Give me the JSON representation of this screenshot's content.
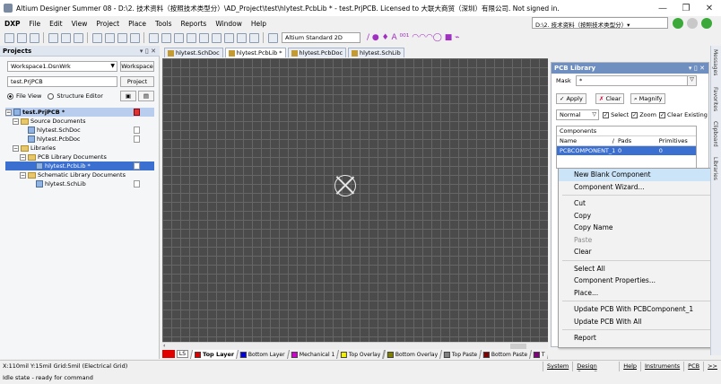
{
  "window": {
    "title": "Altium Designer Summer 08 - D:\\2. 技术资料（按照技术类型分）\\AD_Project\\test\\hlytest.PcbLib * - test.PrjPCB. Licensed to 大联大商贸（深圳）有限公司. Not signed in.",
    "minimize": "—",
    "restore": "❐",
    "close": "✕"
  },
  "menu": {
    "items": [
      "DXP",
      "File",
      "Edit",
      "View",
      "Project",
      "Place",
      "Tools",
      "Reports",
      "Window",
      "Help"
    ],
    "path": "D:\\2. 技术资料（按照技术类型分）▾"
  },
  "toolbar": {
    "view_select": "Altium Standard 2D",
    "glyphs": "/ ● ♦ A ⁰⁰¹ ◠◠◠◯ ■ ⌁"
  },
  "projects_panel": {
    "title": "Projects",
    "pin": "▾ ▯ ✕",
    "workspace": "Workspace1.DsnWrk",
    "workspace_btn": "Workspace",
    "project": "test.PrjPCB",
    "project_btn": "Project",
    "file_view": "File View",
    "structure_editor": "Structure Editor",
    "tree": [
      {
        "label": "test.PrjPCB *",
        "level": 0,
        "kind": "project"
      },
      {
        "label": "Source Documents",
        "level": 1,
        "kind": "folder"
      },
      {
        "label": "hlytest.SchDoc",
        "level": 2,
        "kind": "doc"
      },
      {
        "label": "hlytest.PcbDoc",
        "level": 2,
        "kind": "doc"
      },
      {
        "label": "Libraries",
        "level": 1,
        "kind": "folder"
      },
      {
        "label": "PCB Library Documents",
        "level": 2,
        "kind": "folder"
      },
      {
        "label": "hlytest.PcbLib *",
        "level": 3,
        "kind": "selected"
      },
      {
        "label": "Schematic Library Documents",
        "level": 2,
        "kind": "folder"
      },
      {
        "label": "hlytest.SchLib",
        "level": 3,
        "kind": "doc"
      }
    ]
  },
  "doc_tabs": [
    "hlytest.SchDoc",
    "hlytest.PcbLib *",
    "hlytest.PcbDoc",
    "hlytest.SchLib"
  ],
  "layers": {
    "ls": "LS",
    "items": [
      {
        "label": "Top Layer",
        "color": "#e00000",
        "active": true
      },
      {
        "label": "Bottom Layer",
        "color": "#0000e0"
      },
      {
        "label": "Mechanical 1",
        "color": "#d000d0"
      },
      {
        "label": "Top Overlay",
        "color": "#f0f000"
      },
      {
        "label": "Bottom Overlay",
        "color": "#808000"
      },
      {
        "label": "Top Paste",
        "color": "#808080"
      },
      {
        "label": "Bottom Paste",
        "color": "#800000"
      },
      {
        "label": "T",
        "color": "#800080"
      }
    ]
  },
  "pcb_library": {
    "title": "PCB Library",
    "pin": "▾ ▯ ✕",
    "mask_label": "Mask",
    "mask_value": "*",
    "apply": "Apply",
    "clear": "Clear",
    "magnify": "Magnify",
    "normal": "Normal",
    "select": "Select",
    "zoom": "Zoom",
    "clear_existing": "Clear Existing",
    "components_caption": "Components",
    "col_name": "Name",
    "col_sort": "/",
    "col_pads": "Pads",
    "col_primitives": "Primitives",
    "row": {
      "name": "PCBCOMPONENT_1",
      "pads": "0",
      "primitives": "0"
    }
  },
  "context_menu": {
    "groups": [
      [
        "New Blank Component",
        "Component Wizard..."
      ],
      [
        "Cut",
        "Copy",
        "Copy Name",
        "Paste",
        "Clear"
      ],
      [
        "Select All",
        "Component Properties...",
        "Place..."
      ],
      [
        "Update PCB With PCBComponent_1",
        "Update PCB With All"
      ],
      [
        "Report"
      ]
    ],
    "highlighted": "New Blank Component",
    "disabled": [
      "Paste"
    ]
  },
  "right_tabs": [
    "Messages",
    "Favorites",
    "Clipboard",
    "Libraries"
  ],
  "status": {
    "coords": "X:110mil Y:15mil   Grid:5mil   (Electrical Grid)",
    "panels": [
      "System",
      "Design Compiler",
      "Help",
      "Instruments",
      "PCB",
      ">>"
    ],
    "idle": "Idle state - ready for command"
  }
}
